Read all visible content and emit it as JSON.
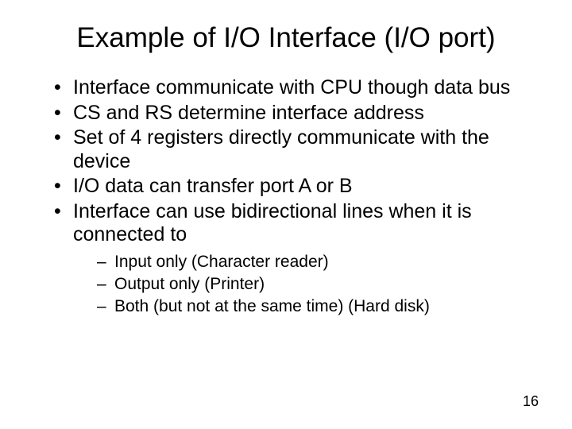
{
  "title": "Example of I/O Interface (I/O port)",
  "bullets": [
    {
      "text": "Interface communicate with CPU though data bus"
    },
    {
      "text": "CS and RS determine interface address"
    },
    {
      "text": "Set of 4 registers directly communicate with the device"
    },
    {
      "text": "I/O data can transfer port A or B"
    },
    {
      "text": "Interface can use bidirectional lines when it is connected to",
      "sub": [
        "Input only (Character reader)",
        "Output only (Printer)",
        "Both (but not at the same time) (Hard disk)"
      ]
    }
  ],
  "page_number": "16"
}
